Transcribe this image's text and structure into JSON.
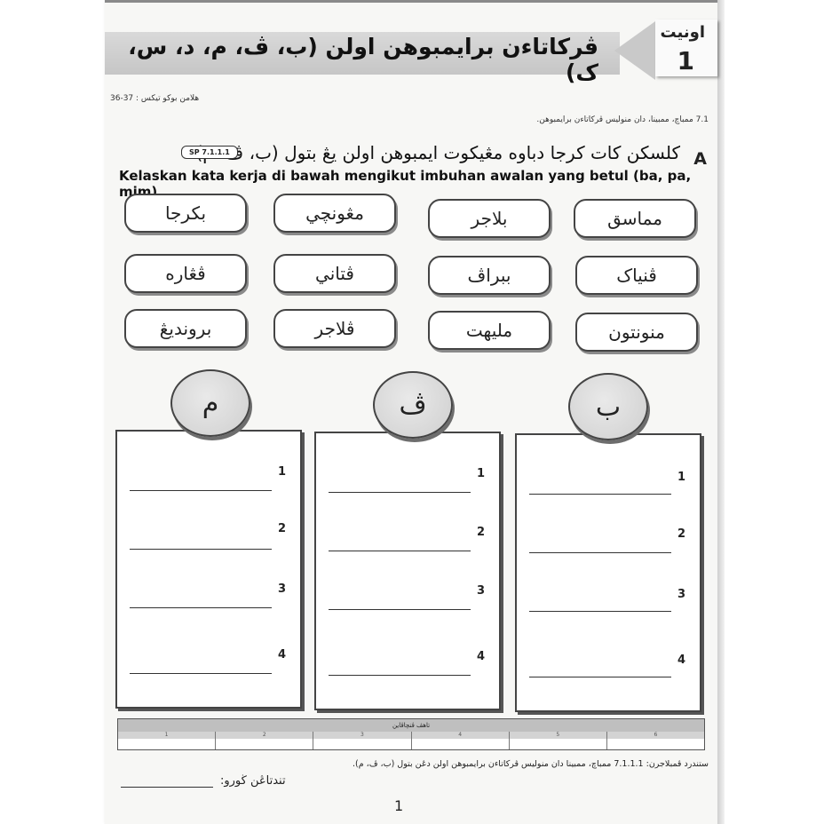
{
  "header": {
    "title": "ڤركاتاءن برايمبوهن اولن (ب، ڤ، م، د، س، ک)",
    "unit_label": "اونيت",
    "unit_number": "1"
  },
  "refs": {
    "textbook_pages": "هلامن بوکو تيکس : 37-36",
    "skill": "7.1 ممباچ، ممبينا، دان منوليس ڤرکاتاءن برايمبوهن."
  },
  "exercise": {
    "letter": "A",
    "instruction_jawi": "کلسکن کات کرجا دباوه مڠيکوت ايمبوهن اولن يڠ بتول (ب، ڤ، م).",
    "sp_badge": "SP 7.1.1.1",
    "instruction_rumi": "Kelaskan kata kerja di bawah mengikut imbuhan awalan yang betul (ba, pa, mim)."
  },
  "words": [
    [
      "بکرجا",
      "مڠونچي",
      "بلاجر",
      "مماسق"
    ],
    [
      "ڤڠاره",
      "ڤتاني",
      "ببراڤ",
      "ڤنياک"
    ],
    [
      "برونديڠ",
      "ڤلاجر",
      "مليهت",
      "منونتون"
    ]
  ],
  "categories": [
    {
      "letter": "م",
      "rows": [
        "1",
        "2",
        "3",
        "4"
      ]
    },
    {
      "letter": "ڤ",
      "rows": [
        "1",
        "2",
        "3",
        "4"
      ]
    },
    {
      "letter": "ب",
      "rows": [
        "1",
        "2",
        "3",
        "4"
      ]
    }
  ],
  "performance_table": {
    "title": "تاهڤ ڤنچاڤاين",
    "levels": [
      "1",
      "2",
      "3",
      "4",
      "5",
      "6"
    ]
  },
  "footer": {
    "standard": "ستندرد ڤمبلاجرن: 7.1.1.1 ممباچ، ممبينا دان منوليس ڤرکاتاءن برايمبوهن اولن دڠن بتول (ب، ڤ، م).",
    "teacher_signature_label": "تندتاڠن ڬورو:",
    "page_number": "1"
  }
}
